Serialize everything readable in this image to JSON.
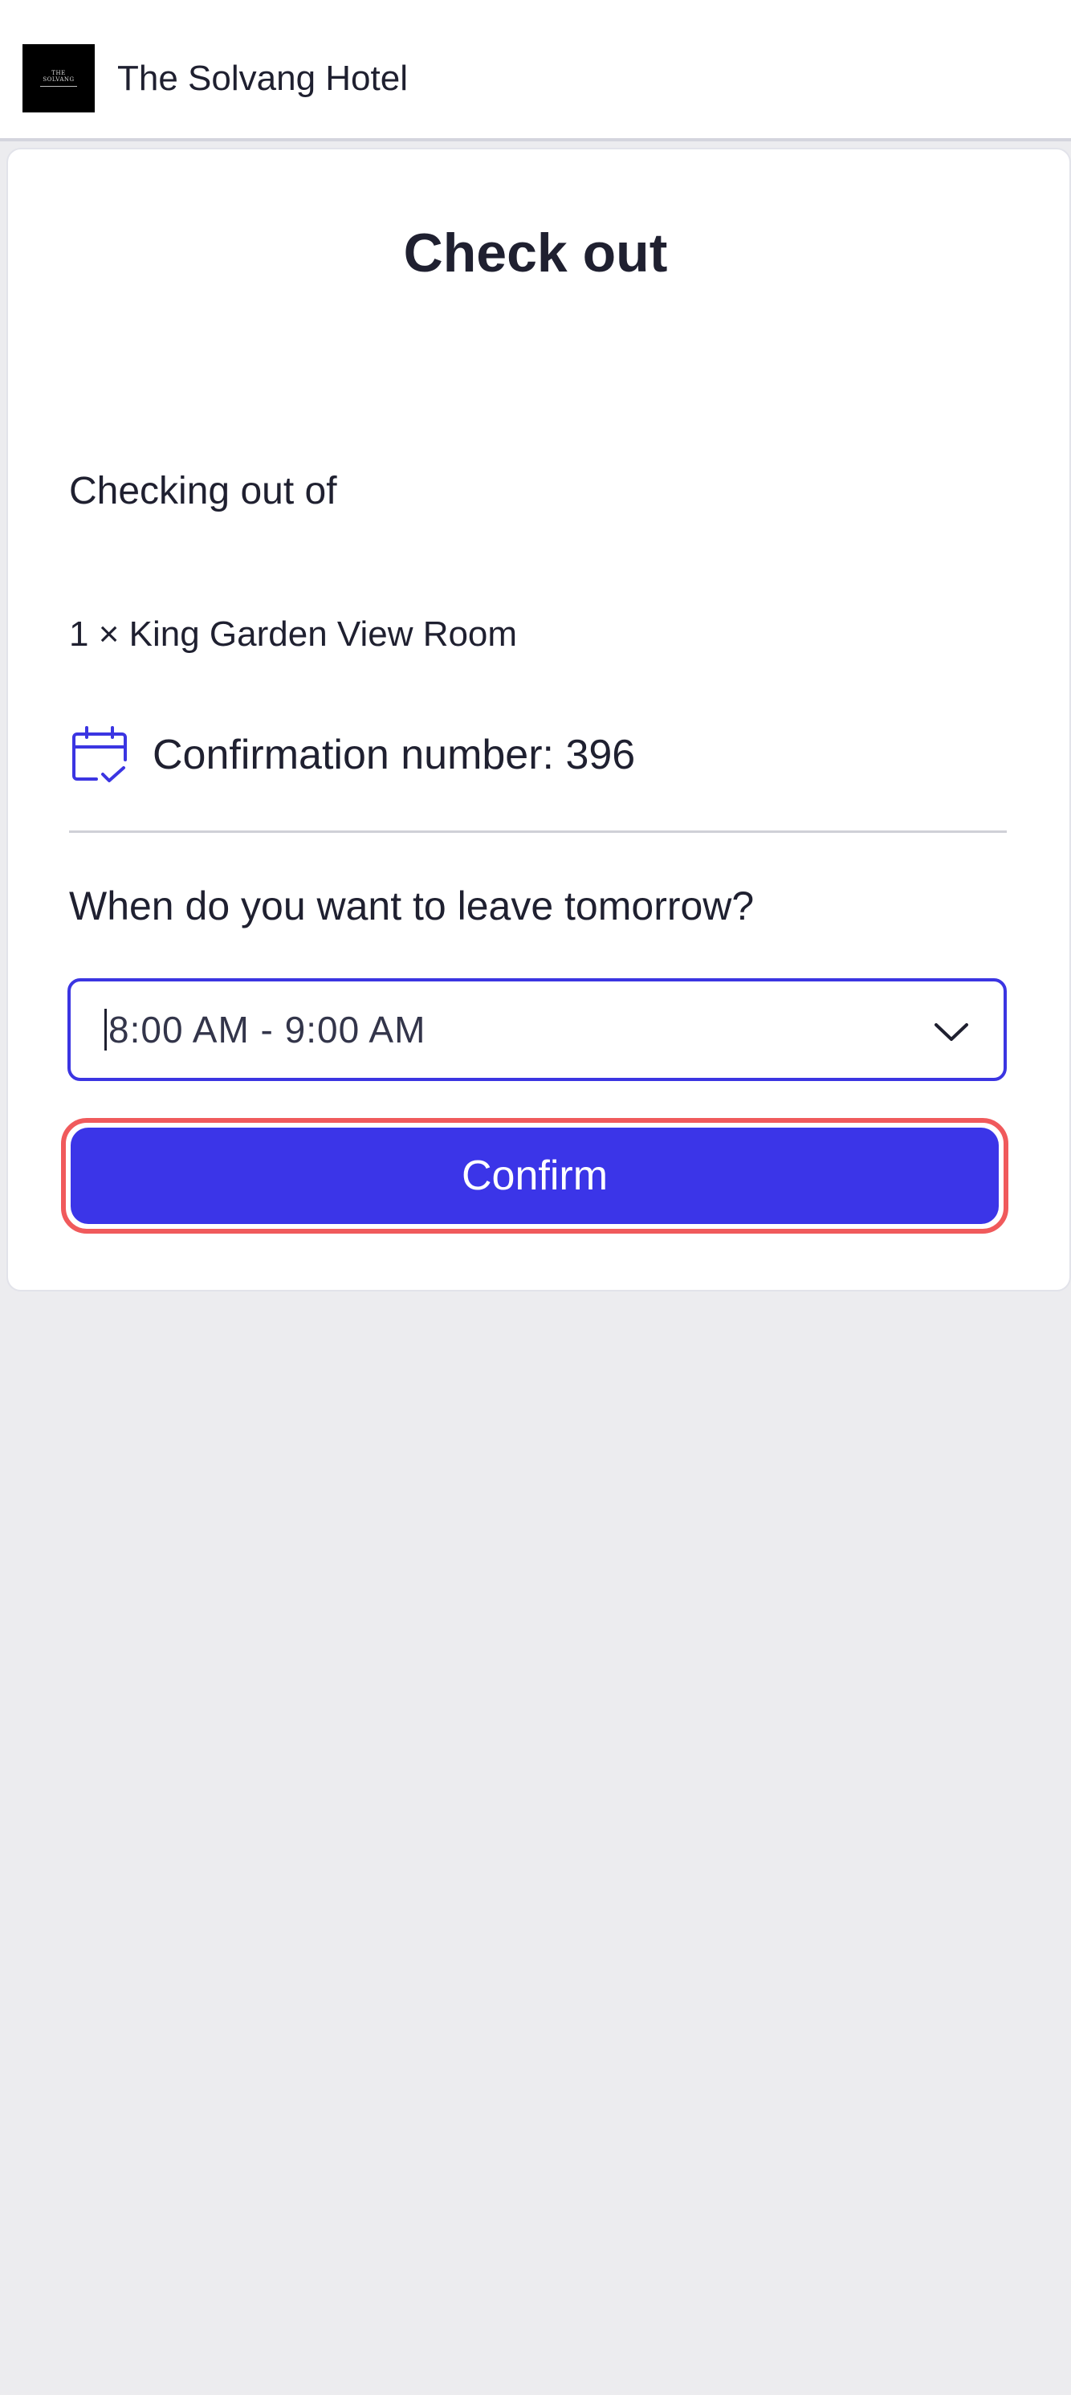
{
  "header": {
    "logo": {
      "line1": "THE",
      "line2": "SOLVANG"
    },
    "hotel_name": "The Solvang Hotel"
  },
  "checkout": {
    "title": "Check out",
    "checking_out_label": "Checking out of",
    "room": "1 × King Garden View Room",
    "confirmation_icon": "calendar-check-icon",
    "confirmation_text": "Confirmation number: 396",
    "question": "When do you want to leave tomorrow?",
    "departure_time": "8:00 AM - 9:00 AM",
    "confirm_label": "Confirm"
  },
  "colors": {
    "accent": "#3b35e8",
    "highlight": "#f05a5c",
    "page_background": "#ececef"
  }
}
